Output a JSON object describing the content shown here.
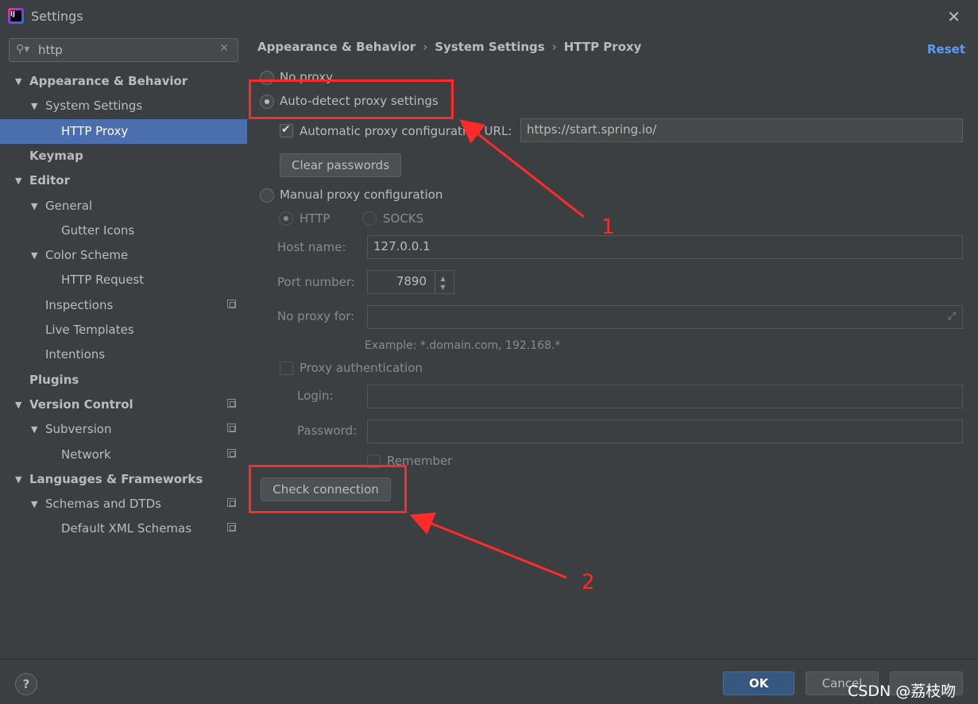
{
  "window": {
    "title": "Settings",
    "close_glyph": "✕"
  },
  "search": {
    "value": "http",
    "icon": "search-icon",
    "clear_glyph": "✕"
  },
  "tree": [
    {
      "label": "Appearance & Behavior",
      "level": 0,
      "bold": true,
      "arrow": "▼"
    },
    {
      "label": "System Settings",
      "level": 1,
      "bold": false,
      "arrow": "▼"
    },
    {
      "label": "HTTP Proxy",
      "level": 2,
      "bold": false,
      "selected": true
    },
    {
      "label": "Keymap",
      "level": 0,
      "bold": true
    },
    {
      "label": "Editor",
      "level": 0,
      "bold": true,
      "arrow": "▼"
    },
    {
      "label": "General",
      "level": 1,
      "bold": false,
      "arrow": "▼"
    },
    {
      "label": "Gutter Icons",
      "level": 2,
      "bold": false
    },
    {
      "label": "Color Scheme",
      "level": 1,
      "bold": false,
      "arrow": "▼"
    },
    {
      "label": "HTTP Request",
      "level": 2,
      "bold": false
    },
    {
      "label": "Inspections",
      "level": 1,
      "bold": false,
      "copy": true
    },
    {
      "label": "Live Templates",
      "level": 1,
      "bold": false
    },
    {
      "label": "Intentions",
      "level": 1,
      "bold": false
    },
    {
      "label": "Plugins",
      "level": 0,
      "bold": true
    },
    {
      "label": "Version Control",
      "level": 0,
      "bold": true,
      "arrow": "▼",
      "copy": true
    },
    {
      "label": "Subversion",
      "level": 1,
      "bold": false,
      "arrow": "▼",
      "copy": true
    },
    {
      "label": "Network",
      "level": 2,
      "bold": false,
      "copy": true
    },
    {
      "label": "Languages & Frameworks",
      "level": 0,
      "bold": true,
      "arrow": "▼"
    },
    {
      "label": "Schemas and DTDs",
      "level": 1,
      "bold": false,
      "arrow": "▼",
      "copy": true
    },
    {
      "label": "Default XML Schemas",
      "level": 2,
      "bold": false,
      "copy": true
    }
  ],
  "breadcrumb": {
    "parts": [
      "Appearance & Behavior",
      "System Settings",
      "HTTP Proxy"
    ],
    "sep": "›"
  },
  "reset_label": "Reset",
  "proxy": {
    "no_proxy": "No proxy",
    "auto_detect": "Auto-detect proxy settings",
    "auto_config_label": "Automatic proxy configuration URL:",
    "auto_config_url": "https://start.spring.io/",
    "clear_passwords": "Clear passwords",
    "manual": "Manual proxy configuration",
    "http": "HTTP",
    "socks": "SOCKS",
    "host_label": "Host name:",
    "host_value": "127.0.0.1",
    "port_label": "Port number:",
    "port_value": "7890",
    "no_proxy_for_label": "No proxy for:",
    "example": "Example: *.domain.com, 192.168.*",
    "auth_label": "Proxy authentication",
    "login_label": "Login:",
    "password_label": "Password:",
    "remember": "Remember",
    "check_connection": "Check connection"
  },
  "footer": {
    "help": "?",
    "ok": "OK",
    "cancel": "Cancel",
    "watermark": "CSDN @荔枝吻"
  },
  "annotations": {
    "one": "1",
    "two": "2",
    "color": "#ff2a2a"
  },
  "colors": {
    "selection": "#4b6eaf",
    "link": "#589df6",
    "primary_button": "#365880"
  }
}
